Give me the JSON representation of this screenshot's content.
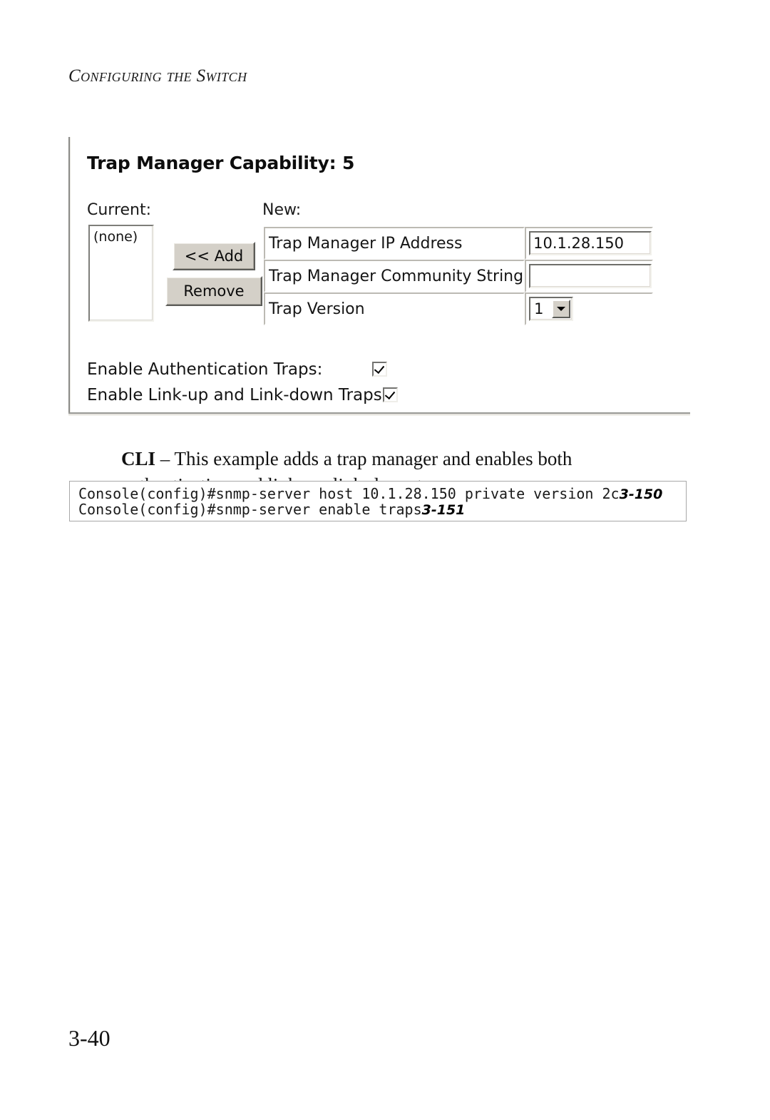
{
  "running_head": "Configuring the Switch",
  "page_number": "3-40",
  "screenshot": {
    "title": "Trap Manager Capability: 5",
    "labels": {
      "current": "Current:",
      "new": "New:"
    },
    "current_list": {
      "items": [
        "(none)"
      ]
    },
    "buttons": {
      "add": "<< Add",
      "remove": "Remove"
    },
    "form_rows": [
      {
        "label": "Trap Manager IP Address",
        "type": "text",
        "value": "10.1.28.150"
      },
      {
        "label": "Trap Manager Community String",
        "type": "text",
        "value": ""
      },
      {
        "label": "Trap Version",
        "type": "select",
        "value": "1"
      }
    ],
    "checkboxes": [
      {
        "label": "Enable Authentication Traps:",
        "checked": true
      },
      {
        "label": "Enable Link-up and Link-down Traps:",
        "checked": true
      }
    ]
  },
  "cli": {
    "tag": "CLI",
    "dash": " – ",
    "description": "This example adds a trap manager and enables both authentication and link-up, link-down traps.",
    "console_lines": [
      {
        "command": "Console(config)#snmp-server host 10.1.28.150 private version 2c",
        "xref": "3-150"
      },
      {
        "command": "Console(config)#snmp-server enable traps",
        "xref": "3-151"
      }
    ]
  },
  "colors": {
    "button_face": "#d4d0c8",
    "page_background": "#ffffff",
    "text": "#111111"
  }
}
